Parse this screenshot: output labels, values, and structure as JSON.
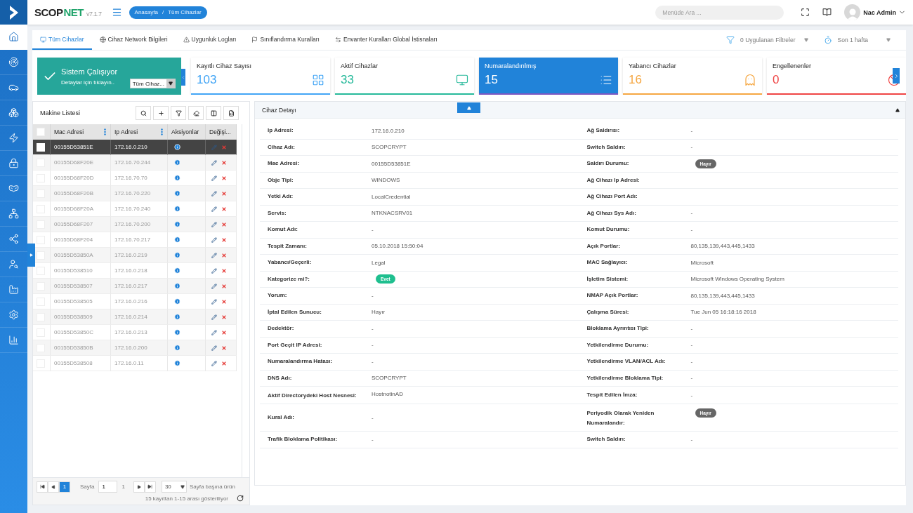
{
  "sidebar": {
    "items": [
      {
        "selected": true
      },
      {
        "selected": false
      },
      {
        "selected": false
      },
      {
        "selected": false
      },
      {
        "selected": false
      },
      {
        "selected": false
      },
      {
        "selected": false
      },
      {
        "selected": false
      },
      {
        "selected": false
      },
      {
        "selected": false
      },
      {
        "selected": false
      },
      {
        "selected": false
      },
      {
        "selected": false
      }
    ]
  },
  "header": {
    "logo": {
      "dark": "SCOP",
      "accent": "NET",
      "version": "v7.1.7"
    },
    "breadcrumb": {
      "items": [
        "Anasayfa",
        "Tüm Cihazlar"
      ],
      "separator": "/"
    },
    "search": {
      "placeholder": "Menüde Ara ..."
    },
    "user": {
      "name": "Nac Admin"
    }
  },
  "tabs": [
    {
      "label": "Tüm Cihazlar",
      "selected": true
    },
    {
      "label": "Cihaz Network Bilgileri",
      "selected": false
    },
    {
      "label": "Uygunluk Logları",
      "selected": false
    },
    {
      "label": "Sınıflandırma Kuralları",
      "selected": false
    },
    {
      "label": "Envanter Kuralları Global İstisnaları",
      "selected": false
    }
  ],
  "filters": [
    {
      "label": "0 Uygulanan Filtreler"
    },
    {
      "label": "Son 1 hafta"
    }
  ],
  "status_card": {
    "title": "Sistem Çalışıyor",
    "subtitle": "Detaylar için tıklayın..",
    "select": "Tüm Cihaz..."
  },
  "stat_cards": [
    {
      "title": "Kayıtlı Cihaz Sayısı",
      "value": "103",
      "color": "#42a5f5",
      "selected": false
    },
    {
      "title": "Aktif Cihazlar",
      "value": "33",
      "color": "#26b99a",
      "selected": false
    },
    {
      "title": "Numaralandırılmış",
      "value": "15",
      "color": "#7e57c2",
      "selected": true
    },
    {
      "title": "Yabancı Cihazlar",
      "value": "16",
      "color": "#f5a742",
      "selected": false
    },
    {
      "title": "Engellenenler",
      "value": "0",
      "color": "#ef4444",
      "selected": false
    }
  ],
  "machine_list": {
    "title": "Makine Listesi",
    "select_all_checked": false,
    "columns": [
      "Mac Adresi",
      "Ip Adresi",
      "Aksiyonlar",
      "Değişi..."
    ],
    "rows": [
      {
        "mac": "00155D53851E",
        "ip": "172.16.0.210",
        "selected": true
      },
      {
        "mac": "00155D68F20E",
        "ip": "172.16.70.244",
        "selected": false
      },
      {
        "mac": "00155D68F20D",
        "ip": "172.16.70.70",
        "selected": false
      },
      {
        "mac": "00155D68F20B",
        "ip": "172.16.70.220",
        "selected": false
      },
      {
        "mac": "00155D68F20A",
        "ip": "172.16.70.240",
        "selected": false
      },
      {
        "mac": "00155D68F207",
        "ip": "172.16.70.200",
        "selected": false
      },
      {
        "mac": "00155D68F204",
        "ip": "172.16.70.217",
        "selected": false
      },
      {
        "mac": "00155D53850A",
        "ip": "172.16.0.219",
        "selected": false
      },
      {
        "mac": "00155D538510",
        "ip": "172.16.0.218",
        "selected": false
      },
      {
        "mac": "00155D538507",
        "ip": "172.16.0.217",
        "selected": false
      },
      {
        "mac": "00155D538505",
        "ip": "172.16.0.216",
        "selected": false
      },
      {
        "mac": "00155D538509",
        "ip": "172.16.0.214",
        "selected": false
      },
      {
        "mac": "00155D53850C",
        "ip": "172.16.0.213",
        "selected": false
      },
      {
        "mac": "00155D53850B",
        "ip": "172.16.0.200",
        "selected": false
      },
      {
        "mac": "00155D538508",
        "ip": "172.16.0.11",
        "selected": false
      }
    ],
    "pagination": {
      "current": "1",
      "page_label": "Sayfa",
      "page_input": "1",
      "page_total": "1",
      "per_page": "30",
      "per_page_label": "Sayfa başına ürün",
      "summary": "15 kayıttan 1-15 arası gösteriliyor"
    }
  },
  "device_detail": {
    "title": "Cihaz Detayı",
    "rows": [
      {
        "left": {
          "label": "Ip Adresi:",
          "value": "172.16.0.210",
          "kind": "text"
        },
        "right": {
          "label": "Ağ Saldırısı:",
          "value": "-",
          "kind": "text"
        }
      },
      {
        "left": {
          "label": "Cihaz Adı:",
          "value": "SCOPCRYPT",
          "kind": "text"
        },
        "right": {
          "label": "Switch Saldırı:",
          "value": "-",
          "kind": "text"
        }
      },
      {
        "left": {
          "label": "Mac Adresi:",
          "value": "00155D53851E",
          "kind": "text"
        },
        "right": {
          "label": "Saldırı Durumu:",
          "value": "Hayır",
          "kind": "badge",
          "color": "#666666"
        }
      },
      {
        "left": {
          "label": "Obje Tipi:",
          "value": "WINDOWS",
          "kind": "text"
        },
        "right": {
          "label": "Ağ Cihazı Ip Adresi:"
        }
      },
      {
        "left": {
          "label": "Yetki Adı:",
          "value": "LocalCredential",
          "kind": "text"
        },
        "right": {
          "label": "Ağ Cihazı Port Adı:"
        }
      },
      {
        "left": {
          "label": "Servis:",
          "value": "NTKNACSRV01",
          "kind": "text"
        },
        "right": {
          "label": "Ağ Cihazı Sys Adı:",
          "value": "-",
          "kind": "text"
        }
      },
      {
        "left": {
          "label": "Komut Adı:",
          "value": "-",
          "kind": "text"
        },
        "right": {
          "label": "Komut Durumu:",
          "value": "-",
          "kind": "text"
        }
      },
      {
        "left": {
          "label": "Tespit Zamanı:",
          "value": "05.10.2018 15:50:04",
          "kind": "text"
        },
        "right": {
          "label": "Açık Portlar:",
          "value": "80,135,139,443,445,1433",
          "kind": "text"
        }
      },
      {
        "left": {
          "label": "Yabancı/Geçerli:",
          "value": "Legal",
          "kind": "text"
        },
        "right": {
          "label": "MAC Sağlayıcı:",
          "value": "Microsoft",
          "kind": "text"
        }
      },
      {
        "left": {
          "label": "Kategorize mi?:",
          "value": "Evet",
          "kind": "badge",
          "color": "#1fbf8f"
        },
        "right": {
          "label": "İşletim Sistemi:",
          "value": "Microsoft Windows Operating System",
          "kind": "text"
        }
      },
      {
        "left": {
          "label": "Yorum:",
          "value": "-",
          "kind": "text"
        },
        "right": {
          "label": "NMAP Açık Portlar:",
          "value": "80,135,139,443,445,1433",
          "kind": "text"
        }
      },
      {
        "left": {
          "label": "İptal Edilen Sunucu:",
          "value": "Hayır",
          "kind": "text"
        },
        "right": {
          "label": "Çalışma Süresi:",
          "value": "Tue Jun 05 16:18:16 2018",
          "kind": "text"
        }
      },
      {
        "left": {
          "label": "Dedektör:",
          "value": "-",
          "kind": "text"
        },
        "right": {
          "label": "Bloklama Ayrıntısı Tipi:",
          "value": "-",
          "kind": "text"
        }
      },
      {
        "left": {
          "label": "Port Geçit IP Adresi:",
          "value": "-",
          "kind": "text"
        },
        "right": {
          "label": "Yetkilendirme Durumu:",
          "value": "-",
          "kind": "text"
        }
      },
      {
        "left": {
          "label": "Numaralandırma Hatası:",
          "value": "-",
          "kind": "text"
        },
        "right": {
          "label": "Yetkilendirme VLAN/ACL Adı:",
          "value": "-",
          "kind": "text"
        }
      },
      {
        "left": {
          "label": "DNS Adı:",
          "value": "SCOPCRYPT",
          "kind": "text"
        },
        "right": {
          "label": "Yetkilendirme Bloklama Tipi:",
          "value": "-",
          "kind": "text"
        }
      },
      {
        "left": {
          "label": "Aktif Directorydeki Host Nesnesi:",
          "value": "HostnotinAD",
          "kind": "text"
        },
        "right": {
          "label": "Tespit Edilen İmza:",
          "value": "-",
          "kind": "text"
        }
      },
      {
        "left": {
          "label": "Kural Adı:",
          "value": "-",
          "kind": "text"
        },
        "right": {
          "label": "Periyodik Olarak Yeniden Numaralandır:",
          "value": "Hayır",
          "kind": "badge",
          "color": "#666666"
        }
      },
      {
        "left": {
          "label": "Trafik Bloklama Politikası:",
          "value": "-",
          "kind": "text"
        },
        "right": {
          "label": "Switch Saldırı:",
          "value": "-",
          "kind": "text"
        }
      }
    ]
  }
}
